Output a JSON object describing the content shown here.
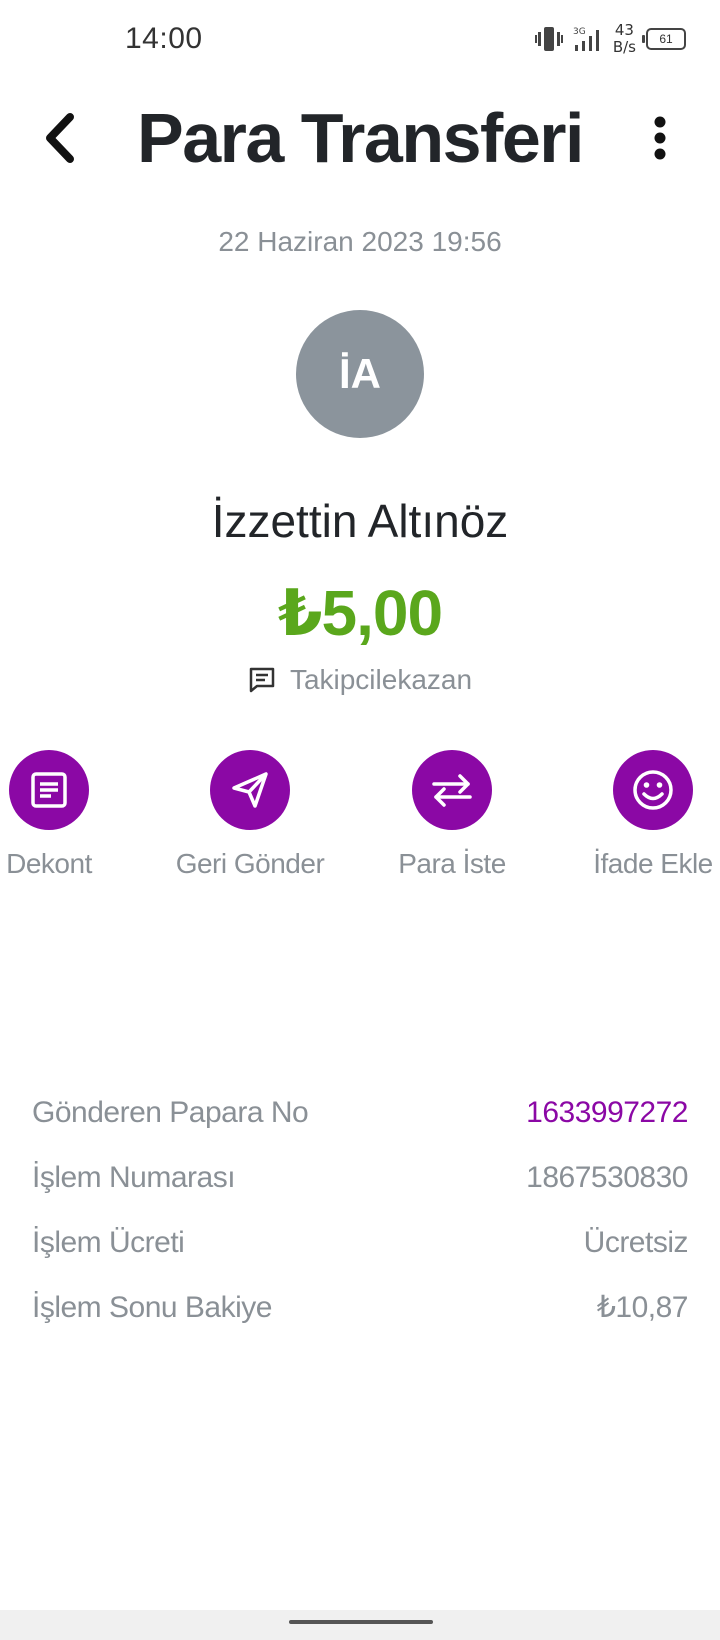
{
  "status_bar": {
    "time": "14:00",
    "net_speed_value": "43",
    "net_speed_unit": "B/s",
    "network_type": "3G",
    "battery": "61"
  },
  "header": {
    "title": "Para Transferi"
  },
  "transaction": {
    "date": "22 Haziran 2023 19:56",
    "avatar_initials": "İA",
    "recipient_name": "İzzettin Altınöz",
    "amount": "₺5,00",
    "note": "Takipcilekazan"
  },
  "actions": [
    {
      "label": "Dekont",
      "icon": "receipt-icon"
    },
    {
      "label": "Geri Gönder",
      "icon": "send-icon"
    },
    {
      "label": "Para İste",
      "icon": "swap-icon"
    },
    {
      "label": "İfade Ekle",
      "icon": "smiley-icon"
    }
  ],
  "details": [
    {
      "label": "Gönderen Papara No",
      "value": "1633997272",
      "accent": true
    },
    {
      "label": "İşlem Numarası",
      "value": "1867530830",
      "accent": false
    },
    {
      "label": "İşlem Ücreti",
      "value": "Ücretsiz",
      "accent": false
    },
    {
      "label": "İşlem Sonu Bakiye",
      "value": "₺10,87",
      "accent": false
    }
  ],
  "colors": {
    "accent": "#8b08a5",
    "amount": "#5aa71c",
    "muted": "#8a9096",
    "avatar_bg": "#8b949c"
  }
}
